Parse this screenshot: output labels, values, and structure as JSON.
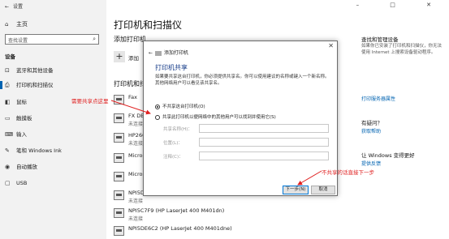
{
  "window": {
    "back_glyph": "←",
    "title": "设置",
    "controls": "–  □  ✕"
  },
  "sidebar": {
    "home": {
      "icon": "home-icon",
      "glyph": "⌂",
      "label": "主页"
    },
    "search_placeholder": "查找设置",
    "search_glyph": "⌕",
    "section": "设备",
    "items": [
      {
        "icon": "bluetooth-icon",
        "glyph": "⊡",
        "label": "蓝牙和其他设备"
      },
      {
        "icon": "printer-icon",
        "glyph": "⎙",
        "label": "打印机和扫描仪",
        "active": true
      },
      {
        "icon": "mouse-icon",
        "glyph": "◧",
        "label": "鼠标"
      },
      {
        "icon": "touchpad-icon",
        "glyph": "▭",
        "label": "触摸板"
      },
      {
        "icon": "keyboard-icon",
        "glyph": "⌨",
        "label": "输入"
      },
      {
        "icon": "pen-icon",
        "glyph": "✎",
        "label": "笔和 Windows Ink"
      },
      {
        "icon": "autoplay-icon",
        "glyph": "◉",
        "label": "自动播放"
      },
      {
        "icon": "usb-icon",
        "glyph": "▢",
        "label": "USB"
      }
    ]
  },
  "main": {
    "title": "打印机和扫描仪",
    "add_title": "添加打印机",
    "add_btn_glyph": "+",
    "add_btn_label": "添加",
    "printers_heading": "打印机和扫",
    "printers": [
      {
        "name": "Fax",
        "status": ""
      },
      {
        "name": "FX DB",
        "status": "未连接"
      },
      {
        "name": "HP260",
        "status": "未连接"
      },
      {
        "name": "Micros",
        "status": ""
      },
      {
        "name": "Micros",
        "status": ""
      },
      {
        "name": "NPI5D",
        "status": "未连接"
      },
      {
        "name": "NPI5C7F9 (HP LaserJet 400 M401dn)",
        "status": "未连接"
      },
      {
        "name": "NPI5DE6C2 (HP LaserJet 400 M401dne)",
        "status": ""
      }
    ]
  },
  "right": {
    "help_heading": "查找和管理设备",
    "help_text": "如果你已安装了打印机和扫描仪，你无法使用 Internet 上搜索设备驱动程序。",
    "link_printer_props": "打印服务器属性",
    "have_question": "有疑问？",
    "get_help": "获取帮助",
    "feedback_heading": "让 Windows 变得更好",
    "feedback_link": "提供反馈"
  },
  "dialog": {
    "close_glyph": "✕",
    "back_glyph": "←",
    "header": "添加打印机",
    "title": "打印机共享",
    "description": "如果要共享这台打印机，你必须提供共享名。你可以使用建议的名称或键入一个新名称。其他网络用户可以看见该共享名。",
    "radio_no_share": "不共享这台打印机(O)",
    "radio_share": "共享此打印机以便网络中的其他用户可以找到并使用它(S)",
    "field_share_name": "共享名称(H)：",
    "field_location": "位置(L)：",
    "field_comment": "注释(C)：",
    "btn_next": "下一步(N)",
    "btn_cancel": "取消"
  },
  "annotations": {
    "left_note": "需要共享点这里",
    "bottom_note": "不共享的话直接下一步",
    "color": "#e02020"
  }
}
